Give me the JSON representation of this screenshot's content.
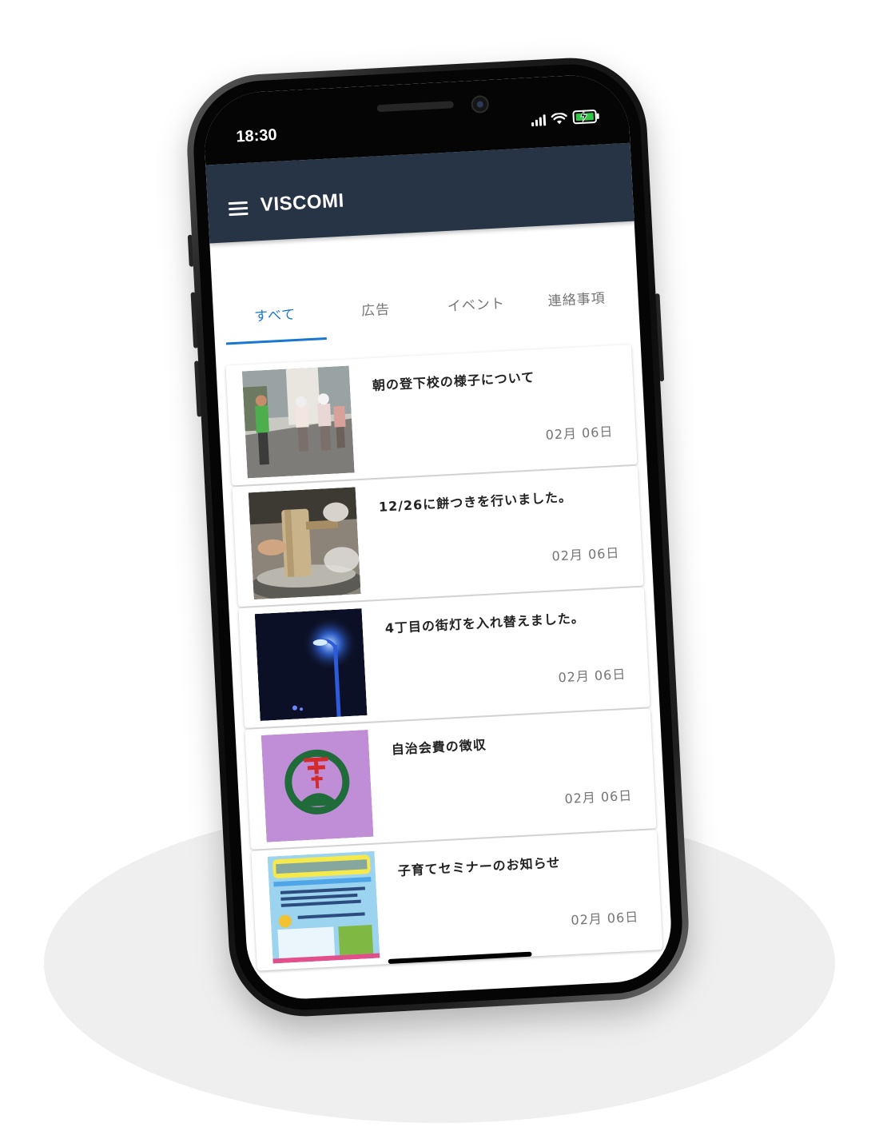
{
  "status_bar": {
    "time": "18:30"
  },
  "app_bar": {
    "title": "VISCOMI",
    "menu_icon": "hamburger-menu-icon",
    "background": "#263445"
  },
  "tabs": [
    {
      "label": "すべて",
      "active": true
    },
    {
      "label": "広告",
      "active": false
    },
    {
      "label": "イベント",
      "active": false
    },
    {
      "label": "連絡事項",
      "active": false
    }
  ],
  "accent_color": "#1976d2",
  "feed": [
    {
      "title": "朝の登下校の様子について",
      "date": "02月  06日"
    },
    {
      "title": "12/26に餅つきを行いました。",
      "date": "02月  06日"
    },
    {
      "title": "4丁目の街灯を入れ替えました。",
      "date": "02月  06日"
    },
    {
      "title": "自治会費の徴収",
      "date": "02月  06日"
    },
    {
      "title": "子育てセミナーのお知らせ",
      "date": "02月  06日"
    }
  ]
}
